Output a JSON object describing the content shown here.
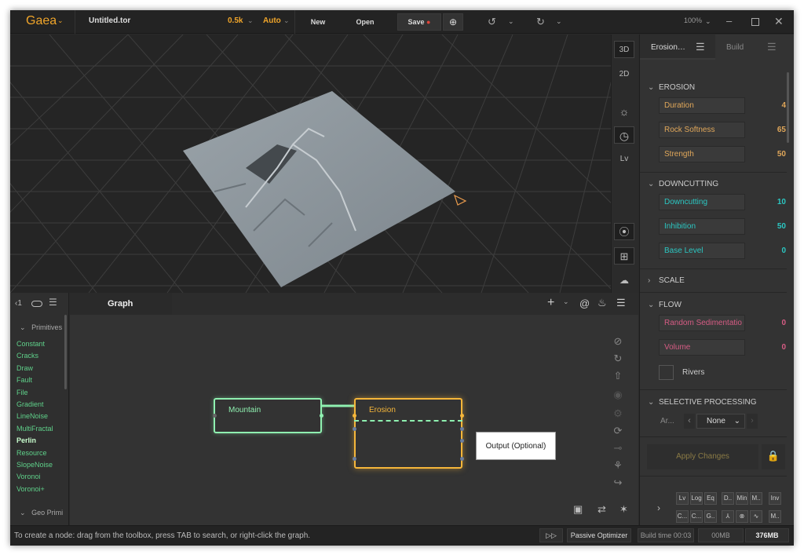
{
  "app": {
    "logo": "Gaea",
    "file": "Untitled.tor",
    "resolution": "0.5k",
    "mode": "Auto",
    "new_label": "New",
    "open_label": "Open",
    "save_label": "Save",
    "zoom": "100%"
  },
  "viewport": {
    "btn_3d": "3D",
    "btn_2d": "2D",
    "btn_lv": "Lv"
  },
  "properties": {
    "tab_active": "Erosion…",
    "tab_build": "Build",
    "erosion": {
      "title": "EROSION",
      "fields": [
        {
          "label": "Duration",
          "value": "4"
        },
        {
          "label": "Rock Softness",
          "value": "65"
        },
        {
          "label": "Strength",
          "value": "50"
        }
      ]
    },
    "downcutting": {
      "title": "DOWNCUTTING",
      "fields": [
        {
          "label": "Downcutting",
          "value": "10"
        },
        {
          "label": "Inhibition",
          "value": "50"
        },
        {
          "label": "Base Level",
          "value": "0"
        }
      ]
    },
    "scale": {
      "title": "SCALE"
    },
    "flow": {
      "title": "FLOW",
      "fields": [
        {
          "label": "Random Sedimentatio",
          "value": "0"
        },
        {
          "label": "Volume",
          "value": "0"
        }
      ],
      "rivers_label": "Rivers"
    },
    "selective": {
      "title": "SELECTIVE PROCESSING",
      "area_label": "Ar...",
      "select_value": "None"
    },
    "apply_label": "Apply Changes",
    "mini_row1": [
      "Lv",
      "Log",
      "Eq",
      "D..",
      "Min",
      "M..",
      "Inv"
    ],
    "mini_row2": [
      "C...",
      "C...",
      "G..",
      "⅄",
      "⊗",
      "∿",
      "M.."
    ]
  },
  "toolbox": {
    "section1": "Primitives",
    "items": [
      "Constant",
      "Cracks",
      "Draw",
      "Fault",
      "File",
      "Gradient",
      "LineNoise",
      "MultiFractal",
      "Perlin",
      "Resource",
      "SlopeNoise",
      "Voronoi",
      "Voronoi+"
    ],
    "section2": "Geo Primi"
  },
  "graph": {
    "tab": "Graph",
    "node_mountain": "Mountain",
    "node_erosion": "Erosion",
    "tooltip": "Output (Optional)"
  },
  "status": {
    "hint": "To create a node: drag from the toolbox, press TAB to search, or right-click the graph.",
    "optimizer": "Passive Optimizer",
    "build_time": "Build time 00:03",
    "mem1": "00MB",
    "mem2": "376MB"
  },
  "colors": {
    "accent": "#f0a52a",
    "erosion_fields": "#e0a75a",
    "down_fields": "#2bc7c2",
    "flow_fields": "#d65c84",
    "node_green": "#8ff0b0",
    "node_orange": "#f5b63a",
    "toolbox_green": "#5fd18a"
  }
}
